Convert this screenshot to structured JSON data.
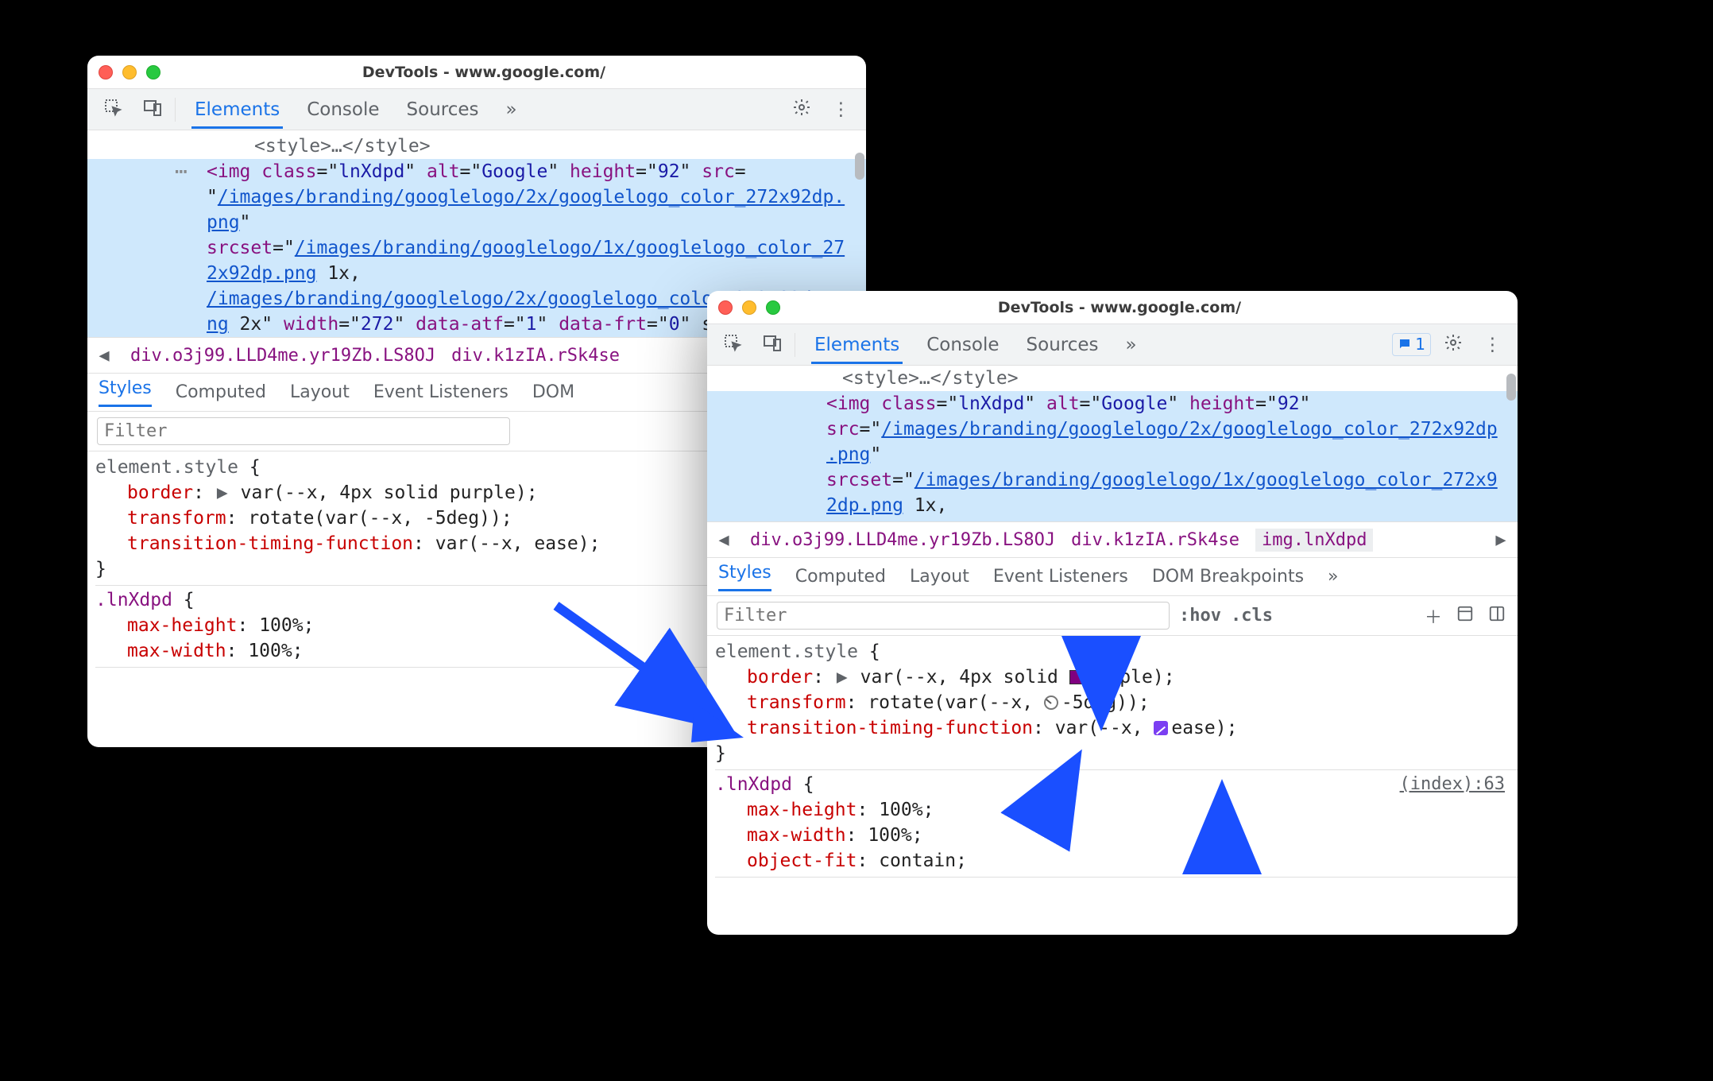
{
  "title": "DevTools - www.google.com/",
  "toolbar": {
    "tabs": {
      "elements": "Elements",
      "console": "Console",
      "sources": "Sources"
    },
    "issues_count": "1"
  },
  "elements": {
    "tag_prefix": "<img ",
    "attr_class": "lnXdpd",
    "attr_alt": "Google",
    "attr_height": "92",
    "src_text": "/images/branding/googlelogo/2x/googlelogo_color_272x92dp.png",
    "srcset1": "/images/branding/googlelogo/1x/googlelogo_color_272x92dp.png",
    "srcset1_suffix": " 1x, ",
    "srcset2": "/images/branding/googlelogo/2x/googlelogo_color_272x92dp.png",
    "srcset2_suffix_left": " 2x\"",
    "attr_width": "272",
    "attr_data_atf": "1",
    "attr_data_frt": "0",
    "inline_style_left": "border: var(--x, 4px solid purple);",
    "faded_style_line": "<style>…</style>"
  },
  "crumbs": {
    "c1": "div.o3j99.LLD4me.yr19Zb.LS8OJ",
    "c2": "div.k1zIA.rSk4se",
    "c3": "img.lnXdpd"
  },
  "styles": {
    "subtabs": {
      "styles": "Styles",
      "computed": "Computed",
      "layout": "Layout",
      "event": "Event Listeners",
      "dom_left": "DOM ",
      "dom_right": "DOM Breakpoints"
    },
    "filter_placeholder": "Filter",
    "hov": ":hov",
    "cls": ".cls",
    "element_style_sel": "element.style",
    "border_prop": "border",
    "border_val": "var(--x, 4px solid purple)",
    "transform_prop": "transform",
    "transform_val": "rotate(var(--x, -5deg))",
    "timing_prop": "transition-timing-function",
    "timing_val": "var(--x, ease)",
    "selector2": ".lnXdpd",
    "mh_prop": "max-height",
    "mh_val": "100%",
    "mw_prop": "max-width",
    "mw_val": "100%",
    "of_prop": "object-fit",
    "of_val": "contain",
    "source_link": "(index):63"
  }
}
